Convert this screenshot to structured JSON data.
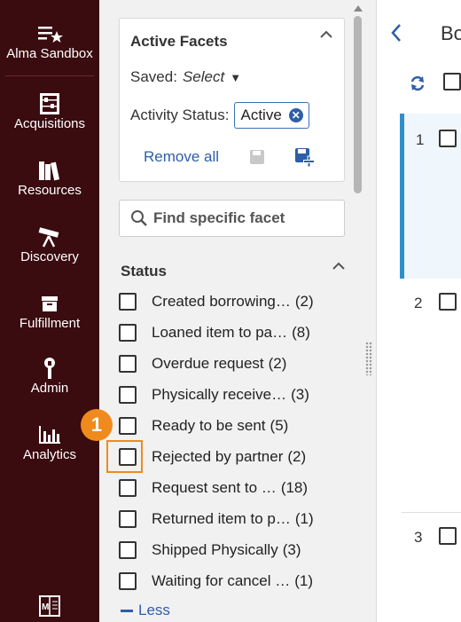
{
  "nav": {
    "items": [
      {
        "label": "Alma Sandbox",
        "icon": "list-star-icon"
      },
      {
        "label": "Acquisitions",
        "icon": "abacus-icon"
      },
      {
        "label": "Resources",
        "icon": "books-icon"
      },
      {
        "label": "Discovery",
        "icon": "telescope-icon"
      },
      {
        "label": "Fulfillment",
        "icon": "inbox-icon"
      },
      {
        "label": "Admin",
        "icon": "wrench-icon"
      },
      {
        "label": "Analytics",
        "icon": "bar-chart-icon"
      }
    ],
    "bottom_icon": "manual-book-icon"
  },
  "active_facets": {
    "title": "Active Facets",
    "saved_label": "Saved:",
    "saved_value": "Select",
    "activity_label": "Activity Status:",
    "activity_chip": "Active",
    "remove_all": "Remove all"
  },
  "search": {
    "placeholder": "Find specific facet"
  },
  "status": {
    "title": "Status",
    "items": [
      {
        "name": "Created borrowing…",
        "count": "(2)"
      },
      {
        "name": "Loaned item to pa…",
        "count": "(8)"
      },
      {
        "name": "Overdue request",
        "count": "(2)"
      },
      {
        "name": "Physically receive…",
        "count": "(3)"
      },
      {
        "name": "Ready to be sent",
        "count": "(5)"
      },
      {
        "name": "Rejected by partner",
        "count": "(2)"
      },
      {
        "name": "Request sent to …",
        "count": "(18)"
      },
      {
        "name": "Returned item to p…",
        "count": "(1)"
      },
      {
        "name": "Shipped Physically",
        "count": "(3)"
      },
      {
        "name": "Waiting for cancel …",
        "count": "(1)"
      }
    ],
    "less_label": "Less"
  },
  "callout": {
    "number": "1"
  },
  "main": {
    "title": "Bo",
    "rows": [
      "1",
      "2",
      "3"
    ]
  },
  "colors": {
    "nav_bg": "#3a0b0f",
    "link": "#2e5ea8",
    "callout": "#f08a1c",
    "selected_row": "#2f8fce"
  }
}
